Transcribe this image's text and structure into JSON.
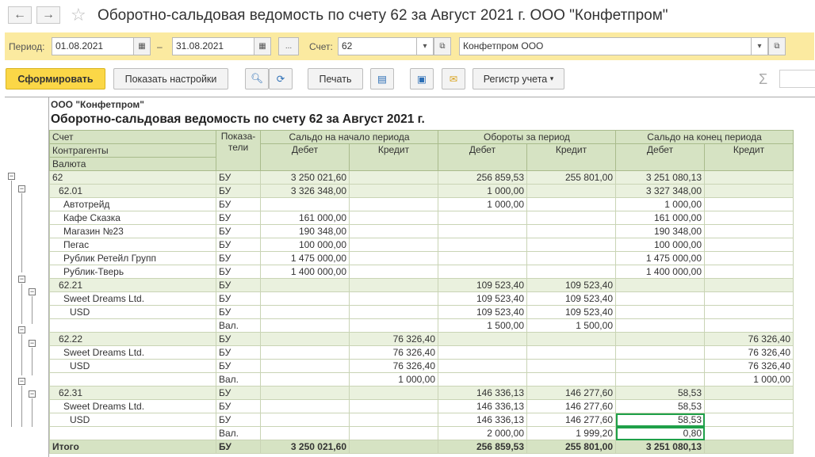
{
  "window": {
    "title": "Оборотно-сальдовая ведомость по счету 62 за Август 2021 г. ООО \"Конфетпром\"",
    "back_icon": "←",
    "forward_icon": "→",
    "star_icon": "☆"
  },
  "params": {
    "period_label": "Период:",
    "date_from": "01.08.2021",
    "dash": "–",
    "date_to": "31.08.2021",
    "more_label": "...",
    "account_label": "Счет:",
    "account": "62",
    "organization": "Конфетпром ООО"
  },
  "toolbar": {
    "generate": "Сформировать",
    "show_settings": "Показать настройки",
    "print": "Печать",
    "register": "Регистр учета",
    "sigma": "Σ"
  },
  "report": {
    "org": "ООО \"Конфетпром\"",
    "title": "Оборотно-сальдовая ведомость по счету 62 за Август 2021 г.",
    "header": {
      "col_account": "Счет",
      "col_counterparties": "Контрагенты",
      "col_currency": "Валюта",
      "col_indicators": "Показа-\nтели",
      "opening": "Сальдо на начало периода",
      "turnover": "Обороты за период",
      "closing": "Сальдо на конец периода",
      "debit": "Дебет",
      "credit": "Кредит"
    },
    "rows": [
      {
        "name": "62",
        "ind": "БУ",
        "od": "3 250 021,60",
        "oc": "",
        "td": "256 859,53",
        "tc": "255 801,00",
        "cd": "3 251 080,13",
        "cc": "",
        "indent": 0,
        "g": true
      },
      {
        "name": "62.01",
        "ind": "БУ",
        "od": "3 326 348,00",
        "oc": "",
        "td": "1 000,00",
        "tc": "",
        "cd": "3 327 348,00",
        "cc": "",
        "indent": 1,
        "g": true
      },
      {
        "name": "Автотрейд",
        "ind": "БУ",
        "od": "",
        "oc": "",
        "td": "1 000,00",
        "tc": "",
        "cd": "1 000,00",
        "cc": "",
        "indent": 2,
        "g": false
      },
      {
        "name": "Кафе Сказка",
        "ind": "БУ",
        "od": "161 000,00",
        "oc": "",
        "td": "",
        "tc": "",
        "cd": "161 000,00",
        "cc": "",
        "indent": 2,
        "g": false
      },
      {
        "name": "Магазин №23",
        "ind": "БУ",
        "od": "190 348,00",
        "oc": "",
        "td": "",
        "tc": "",
        "cd": "190 348,00",
        "cc": "",
        "indent": 2,
        "g": false
      },
      {
        "name": "Пегас",
        "ind": "БУ",
        "od": "100 000,00",
        "oc": "",
        "td": "",
        "tc": "",
        "cd": "100 000,00",
        "cc": "",
        "indent": 2,
        "g": false
      },
      {
        "name": "Рублик Ретейл Групп",
        "ind": "БУ",
        "od": "1 475 000,00",
        "oc": "",
        "td": "",
        "tc": "",
        "cd": "1 475 000,00",
        "cc": "",
        "indent": 2,
        "g": false
      },
      {
        "name": "Рублик-Тверь",
        "ind": "БУ",
        "od": "1 400 000,00",
        "oc": "",
        "td": "",
        "tc": "",
        "cd": "1 400 000,00",
        "cc": "",
        "indent": 2,
        "g": false
      },
      {
        "name": "62.21",
        "ind": "БУ",
        "od": "",
        "oc": "",
        "td": "109 523,40",
        "tc": "109 523,40",
        "cd": "",
        "cc": "",
        "indent": 1,
        "g": true
      },
      {
        "name": "Sweet Dreams Ltd.",
        "ind": "БУ",
        "od": "",
        "oc": "",
        "td": "109 523,40",
        "tc": "109 523,40",
        "cd": "",
        "cc": "",
        "indent": 2,
        "g": false
      },
      {
        "name": "USD",
        "ind": "БУ",
        "od": "",
        "oc": "",
        "td": "109 523,40",
        "tc": "109 523,40",
        "cd": "",
        "cc": "",
        "indent": 3,
        "g": false
      },
      {
        "name": "",
        "ind": "Вал.",
        "od": "",
        "oc": "",
        "td": "1 500,00",
        "tc": "1 500,00",
        "cd": "",
        "cc": "",
        "indent": 3,
        "g": false
      },
      {
        "name": "62.22",
        "ind": "БУ",
        "od": "",
        "oc": "76 326,40",
        "td": "",
        "tc": "",
        "cd": "",
        "cc": "76 326,40",
        "indent": 1,
        "g": true
      },
      {
        "name": "Sweet Dreams Ltd.",
        "ind": "БУ",
        "od": "",
        "oc": "76 326,40",
        "td": "",
        "tc": "",
        "cd": "",
        "cc": "76 326,40",
        "indent": 2,
        "g": false
      },
      {
        "name": "USD",
        "ind": "БУ",
        "od": "",
        "oc": "76 326,40",
        "td": "",
        "tc": "",
        "cd": "",
        "cc": "76 326,40",
        "indent": 3,
        "g": false
      },
      {
        "name": "",
        "ind": "Вал.",
        "od": "",
        "oc": "1 000,00",
        "td": "",
        "tc": "",
        "cd": "",
        "cc": "1 000,00",
        "indent": 3,
        "g": false
      },
      {
        "name": "62.31",
        "ind": "БУ",
        "od": "",
        "oc": "",
        "td": "146 336,13",
        "tc": "146 277,60",
        "cd": "58,53",
        "cc": "",
        "indent": 1,
        "g": true
      },
      {
        "name": "Sweet Dreams Ltd.",
        "ind": "БУ",
        "od": "",
        "oc": "",
        "td": "146 336,13",
        "tc": "146 277,60",
        "cd": "58,53",
        "cc": "",
        "indent": 2,
        "g": false
      },
      {
        "name": "USD",
        "ind": "БУ",
        "od": "",
        "oc": "",
        "td": "146 336,13",
        "tc": "146 277,60",
        "cd": "58,53",
        "cc": "",
        "indent": 3,
        "g": false
      },
      {
        "name": "",
        "ind": "Вал.",
        "od": "",
        "oc": "",
        "td": "2 000,00",
        "tc": "1 999,20",
        "cd": "0,80",
        "cc": "",
        "indent": 3,
        "g": false
      }
    ],
    "total": {
      "name": "Итого",
      "ind": "БУ",
      "od": "3 250 021,60",
      "oc": "",
      "td": "256 859,53",
      "tc": "255 801,00",
      "cd": "3 251 080,13",
      "cc": ""
    }
  }
}
